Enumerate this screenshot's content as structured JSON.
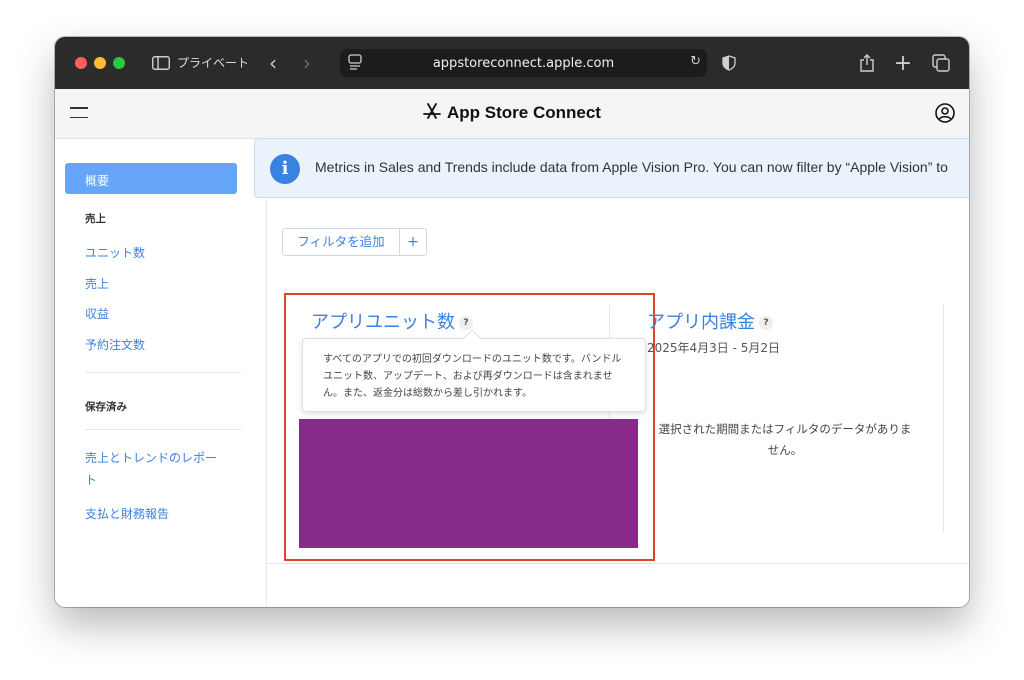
{
  "browser": {
    "private_label": "プライベート",
    "url": "appstoreconnect.apple.com"
  },
  "header": {
    "title": "App Store Connect"
  },
  "sidebar": {
    "active_item": "概要",
    "sales_heading": "売上",
    "sales_items": [
      "ユニット数",
      "売上",
      "収益",
      "予約注文数"
    ],
    "saved_heading": "保存済み",
    "reports": [
      "売上とトレンドのレポー\nト",
      "支払と財務報告"
    ]
  },
  "banner": {
    "text": "Metrics in Sales and Trends include data from Apple Vision Pro. You can now filter by “Apple Vision” to"
  },
  "filters": {
    "add_label": "フィルタを追加",
    "plus_label": "+"
  },
  "cards": [
    {
      "title": "アプリユニット数",
      "help": "?",
      "tooltip": "すべてのアプリでの初回ダウンロードのユニット数です。バンドルユニット数、アップデート、および再ダウンロードは含まれません。また、返金分は総数から差し引かれます。"
    },
    {
      "title": "アプリ内課金",
      "help": "?",
      "date_range": "2025年4月3日 - 5月2日",
      "empty_message": "選択された期間またはフィルタのデータがありません。"
    }
  ],
  "colors": {
    "accent": "#3a82e0",
    "active_nav": "#64a5f7",
    "highlight_border": "#e0432a",
    "chart_fill": "#882a88"
  }
}
